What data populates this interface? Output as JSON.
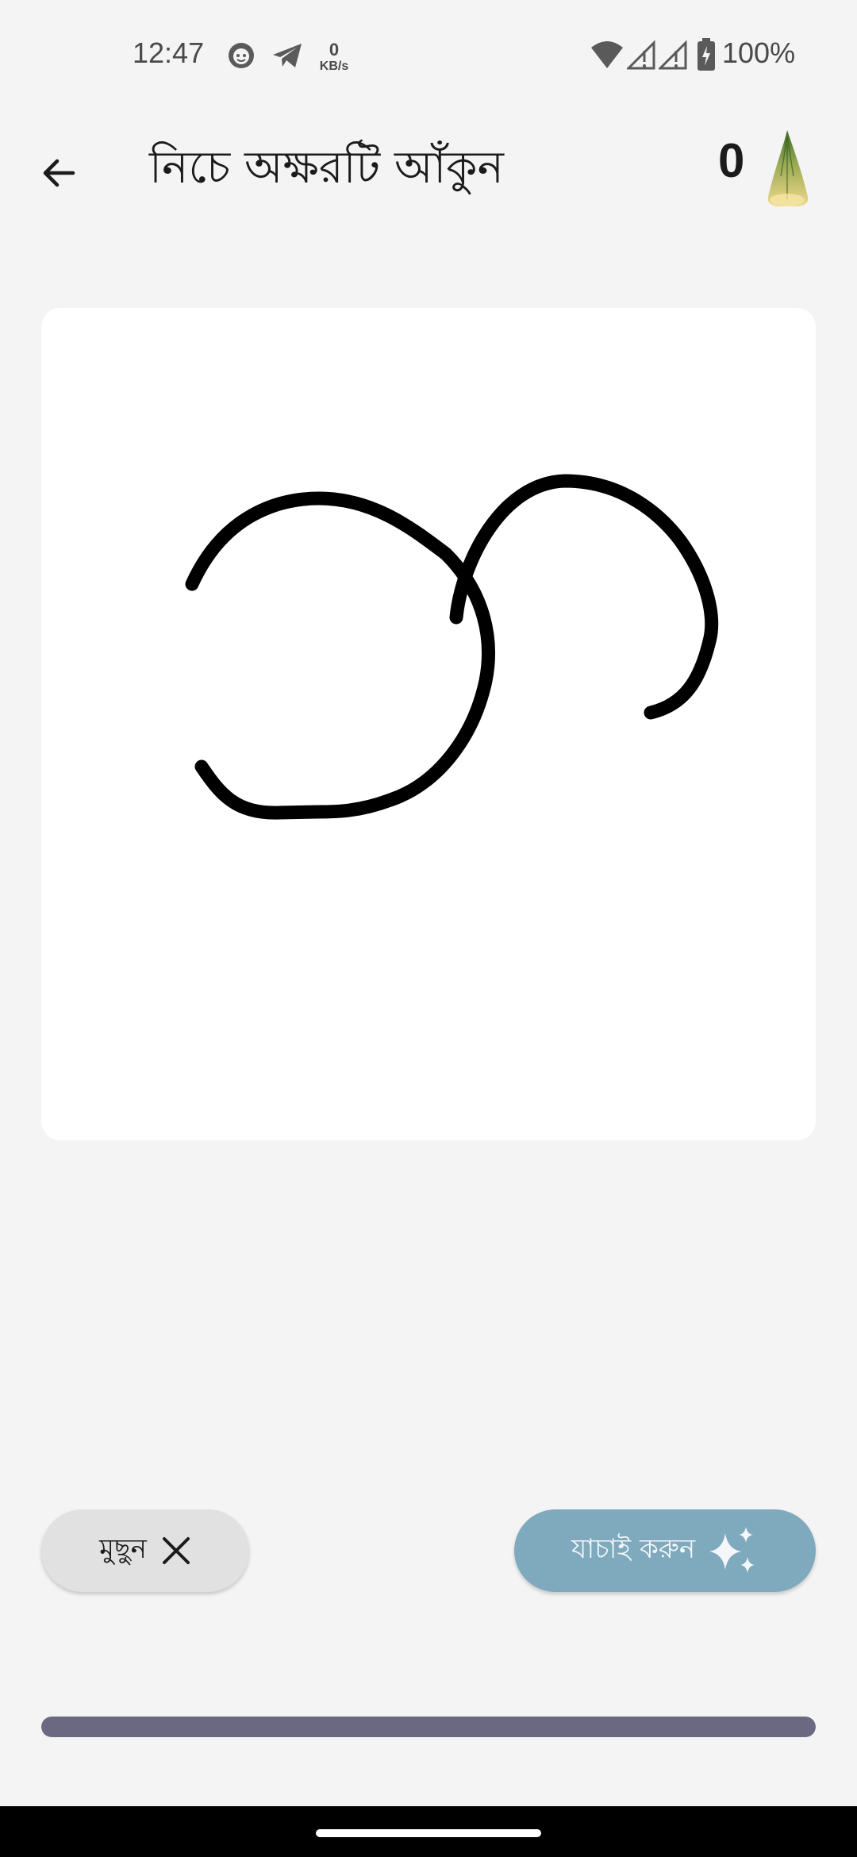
{
  "status_bar": {
    "time": "12:47",
    "network_speed_value": "0",
    "network_speed_unit": "KB/s",
    "battery_percent": "100%",
    "icons": [
      "face-icon",
      "telegram-icon",
      "wifi-icon",
      "signal-icon",
      "signal-icon",
      "battery-charging-icon"
    ]
  },
  "app_bar": {
    "title": "নিচে অক্ষরটি আঁকুন",
    "score": "0",
    "back_icon": "arrow-left-icon",
    "reward_icon": "bamboo-shoot-icon"
  },
  "drawing": {
    "stroke_color": "#000000",
    "background_color": "#ffffff"
  },
  "actions": {
    "clear_label": "মুছুন",
    "clear_icon": "close-icon",
    "check_label": "যাচাই করুন",
    "check_icon": "sparkle-icon",
    "check_color": "#7fa9bd"
  },
  "progress": {
    "value": 1.0,
    "color": "#6b6882"
  }
}
